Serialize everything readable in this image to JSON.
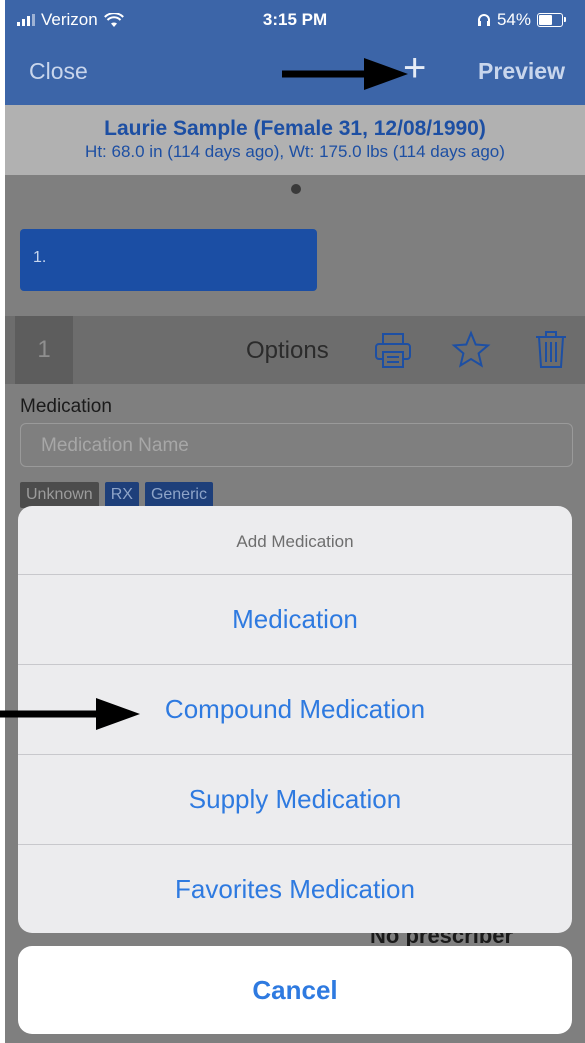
{
  "status_bar": {
    "carrier": "Verizon",
    "time": "3:15 PM",
    "battery": "54%"
  },
  "nav": {
    "close_label": "Close",
    "add_label": "+",
    "preview_label": "Preview"
  },
  "patient": {
    "name_line": "Laurie Sample (Female 31, 12/08/1990)",
    "vitals_line": "Ht: 68.0 in (114 days ago), Wt: 175.0 lbs (114 days ago)"
  },
  "prescription_tile": {
    "label": "1."
  },
  "toolbar": {
    "number": "1",
    "options_label": "Options",
    "icons": [
      "printer-icon",
      "star-icon",
      "trash-icon"
    ]
  },
  "medication": {
    "label": "Medication",
    "placeholder": "Medication Name",
    "tags": [
      "Unknown",
      "RX",
      "Generic"
    ]
  },
  "background_text": {
    "prescriber": "No prescriber"
  },
  "action_sheet": {
    "title": "Add Medication",
    "options": [
      "Medication",
      "Compound Medication",
      "Supply Medication",
      "Favorites Medication"
    ],
    "cancel_label": "Cancel"
  },
  "colors": {
    "nav_bar": "#3c65a8",
    "action_text": "#2e7ae0",
    "tile": "#1b4ea4"
  }
}
